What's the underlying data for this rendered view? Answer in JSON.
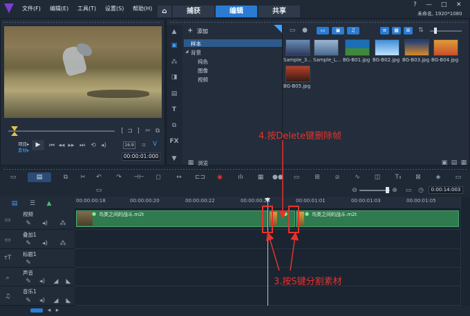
{
  "app": {
    "menus": [
      "文件(F)",
      "编辑(E)",
      "工具(T)",
      "设置(S)",
      "帮助(H)"
    ],
    "home_icon": "home-icon",
    "tabs": [
      "捕获",
      "编辑",
      "共享"
    ],
    "active_tab": "编辑",
    "project_info": "未命名, 1920*1080"
  },
  "player": {
    "mode_labels": [
      "项目▸",
      "素材▸"
    ],
    "timecode": "00:00:01:000",
    "zoom_label": "16:9",
    "v_label": "V"
  },
  "library": {
    "add_label": "添加",
    "tree": [
      "样本",
      "背景",
      "纯色",
      "图像",
      "视频"
    ],
    "browse_label": "浏览",
    "media": [
      {
        "label": "Sample_3...",
        "color": "#3a5a8a"
      },
      {
        "label": "Sample_L...",
        "color": "#5a7fa8"
      },
      {
        "label": "BG-B01.jpg",
        "color": "#1c6fb6"
      },
      {
        "label": "BG-B02.jpg",
        "color": "#3f8fd6"
      },
      {
        "label": "BG-B03.jpg",
        "color": "#d88a2a"
      },
      {
        "label": "BG-B04.jpg",
        "color": "#c8502a"
      },
      {
        "label": "BG-B05.jpg",
        "color": "#b8402a"
      }
    ]
  },
  "timeline": {
    "timecode": "0:00:14:003",
    "ruler": [
      "00:00:00:18",
      "00:00:00:20",
      "00:00:00:22",
      "00:00:00:24",
      "00:00:01:01",
      "00:00:01:03",
      "00:00:01:05"
    ],
    "tracks": [
      {
        "label": "视频",
        "icon": "video-track-icon"
      },
      {
        "label": "叠加1",
        "icon": "overlay-track-icon"
      },
      {
        "label": "标题1",
        "icon": "title-track-icon"
      },
      {
        "label": "声音",
        "icon": "voice-track-icon"
      },
      {
        "label": "音乐1",
        "icon": "music-track-icon"
      }
    ],
    "clip_name": "鸟类之间的战斗.m2t"
  },
  "annotations": {
    "delete_frames": "4.按Delete键删除帧",
    "split_clip": "3.按S键分割素材"
  },
  "colors": {
    "accent": "#2a7cd3",
    "clip": "#2f7a4e",
    "annotation": "#e8322b"
  }
}
